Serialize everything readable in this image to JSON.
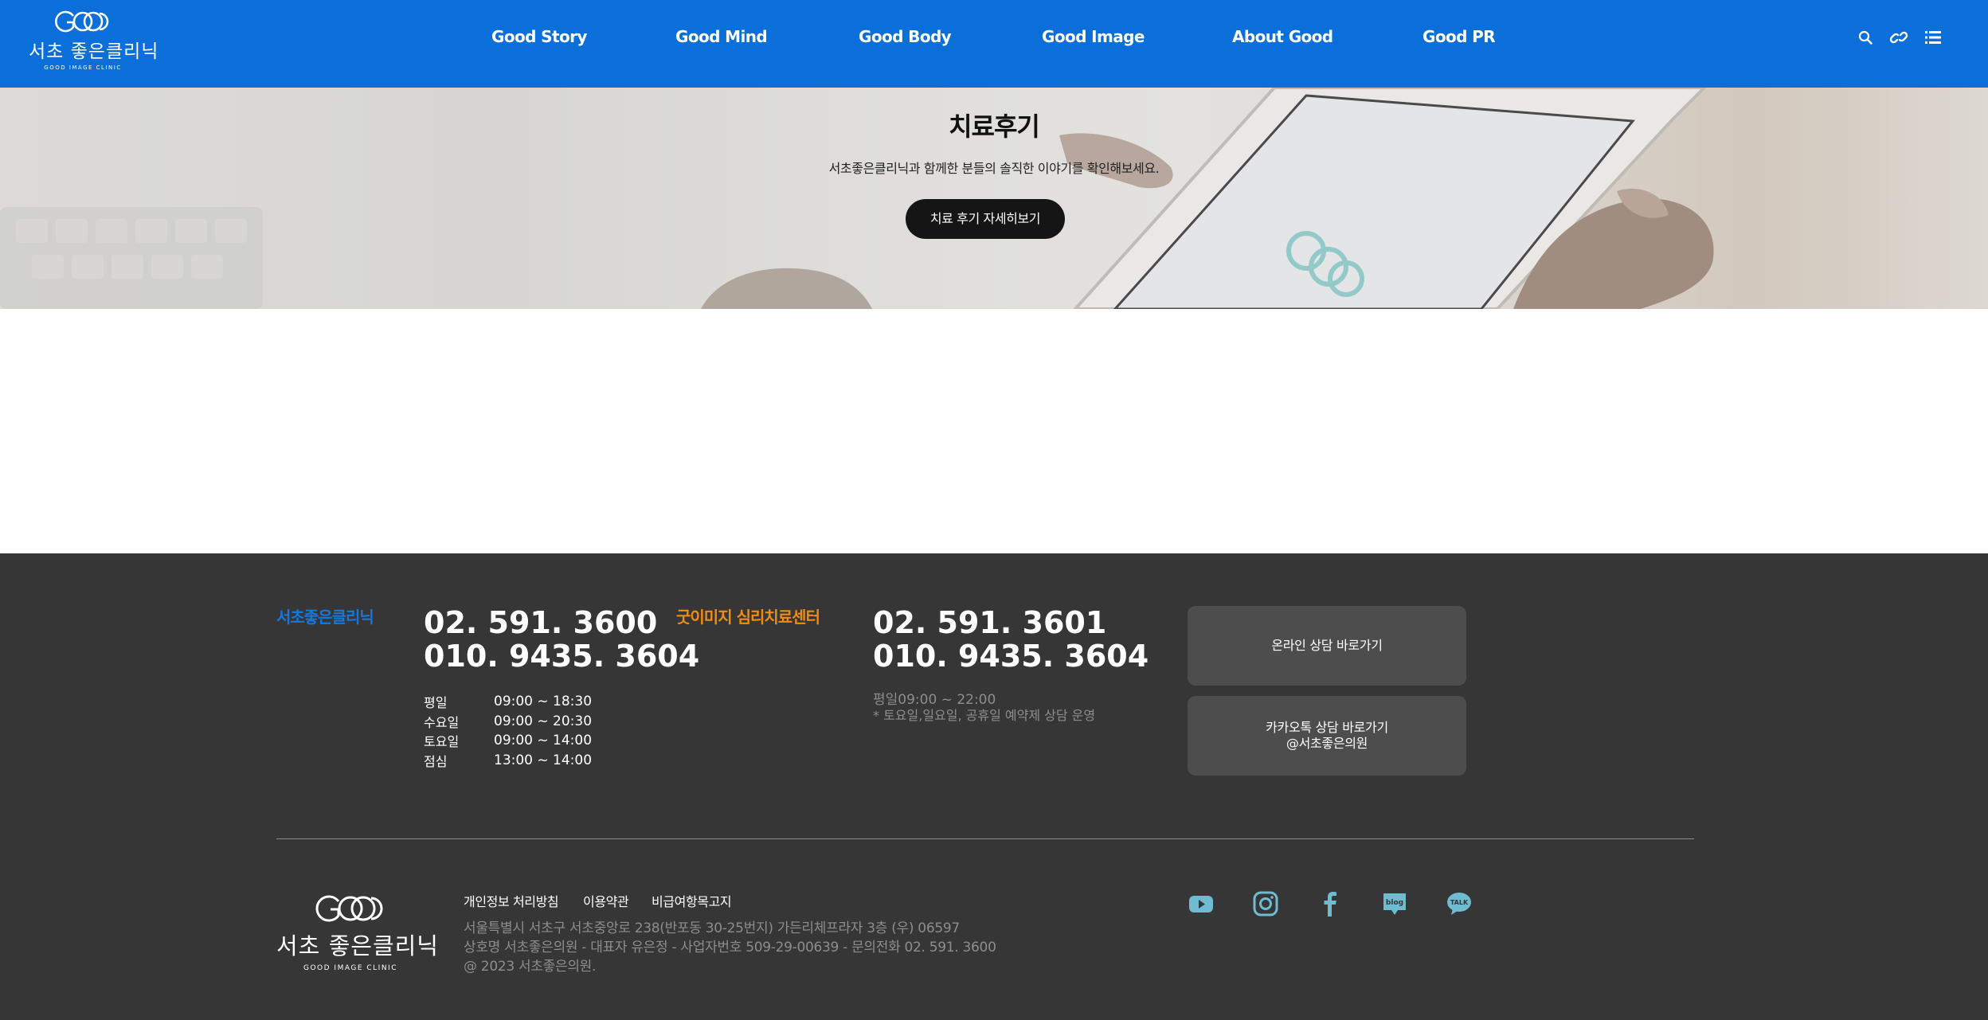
{
  "header": {
    "logo": {
      "ko": "서초 좋은클리닉",
      "en": "GOOD IMAGE CLINIC"
    },
    "nav": [
      "Good Story",
      "Good Mind",
      "Good Body",
      "Good Image",
      "About Good",
      "Good PR"
    ],
    "icons": [
      "search-icon",
      "link-icon",
      "list-icon"
    ],
    "background": "#0a6fd8"
  },
  "hero": {
    "title": "치료후기",
    "subtitle": "서초좋은클리닉과 함께한 분들의 솔직한 이야기를 확인해보세요.",
    "button": "치료 후기 자세히보기"
  },
  "footer": {
    "clinic": {
      "name": "서초좋은클리닉",
      "color": "#1677d9",
      "phones": [
        "02. 591. 3600",
        "010. 9435. 3604"
      ],
      "hours": [
        {
          "day": "평일",
          "time": "09:00 ~ 18:30"
        },
        {
          "day": "수요일",
          "time": "09:00 ~ 20:30"
        },
        {
          "day": "토요일",
          "time": "09:00 ~ 14:00"
        },
        {
          "day": "점심",
          "time": "13:00 ~ 14:00"
        }
      ]
    },
    "psych": {
      "name": "굿이미지 심리치료센터",
      "color": "#f08c12",
      "phones": [
        "02. 591. 3601",
        "010. 9435. 3604"
      ],
      "hours_line": "평일09:00 ~ 22:00",
      "note": "* 토요일,일요일, 공휴일 예약제 상담 운영"
    },
    "buttons": {
      "online": "온라인 상담 바로가기",
      "kakao_line1": "카카오톡 상담 바로가기",
      "kakao_line2": "@서초좋은의원"
    },
    "logo": {
      "ko": "서초 좋은클리닉",
      "en": "GOOD IMAGE CLINIC"
    },
    "links": [
      "개인정보 처리방침",
      "이용약관",
      "비급여항목고지"
    ],
    "info": [
      "서울특별시 서초구 서초중앙로 238(반포동 30-25번지) 가든리체프라자 3층 (우) 06597",
      "상호명 서초좋은의원 - 대표자 유은정 - 사업자번호 509-29-00639 - 문의전화 02. 591. 3600",
      "@ 2023 서초좋은의원."
    ],
    "sns": [
      "youtube-icon",
      "instagram-icon",
      "facebook-icon",
      "blog-icon",
      "kakaotalk-icon"
    ],
    "sns_labels": {
      "blog": "blog",
      "talk": "TALK"
    },
    "sns_color": "#6fbcd0"
  }
}
